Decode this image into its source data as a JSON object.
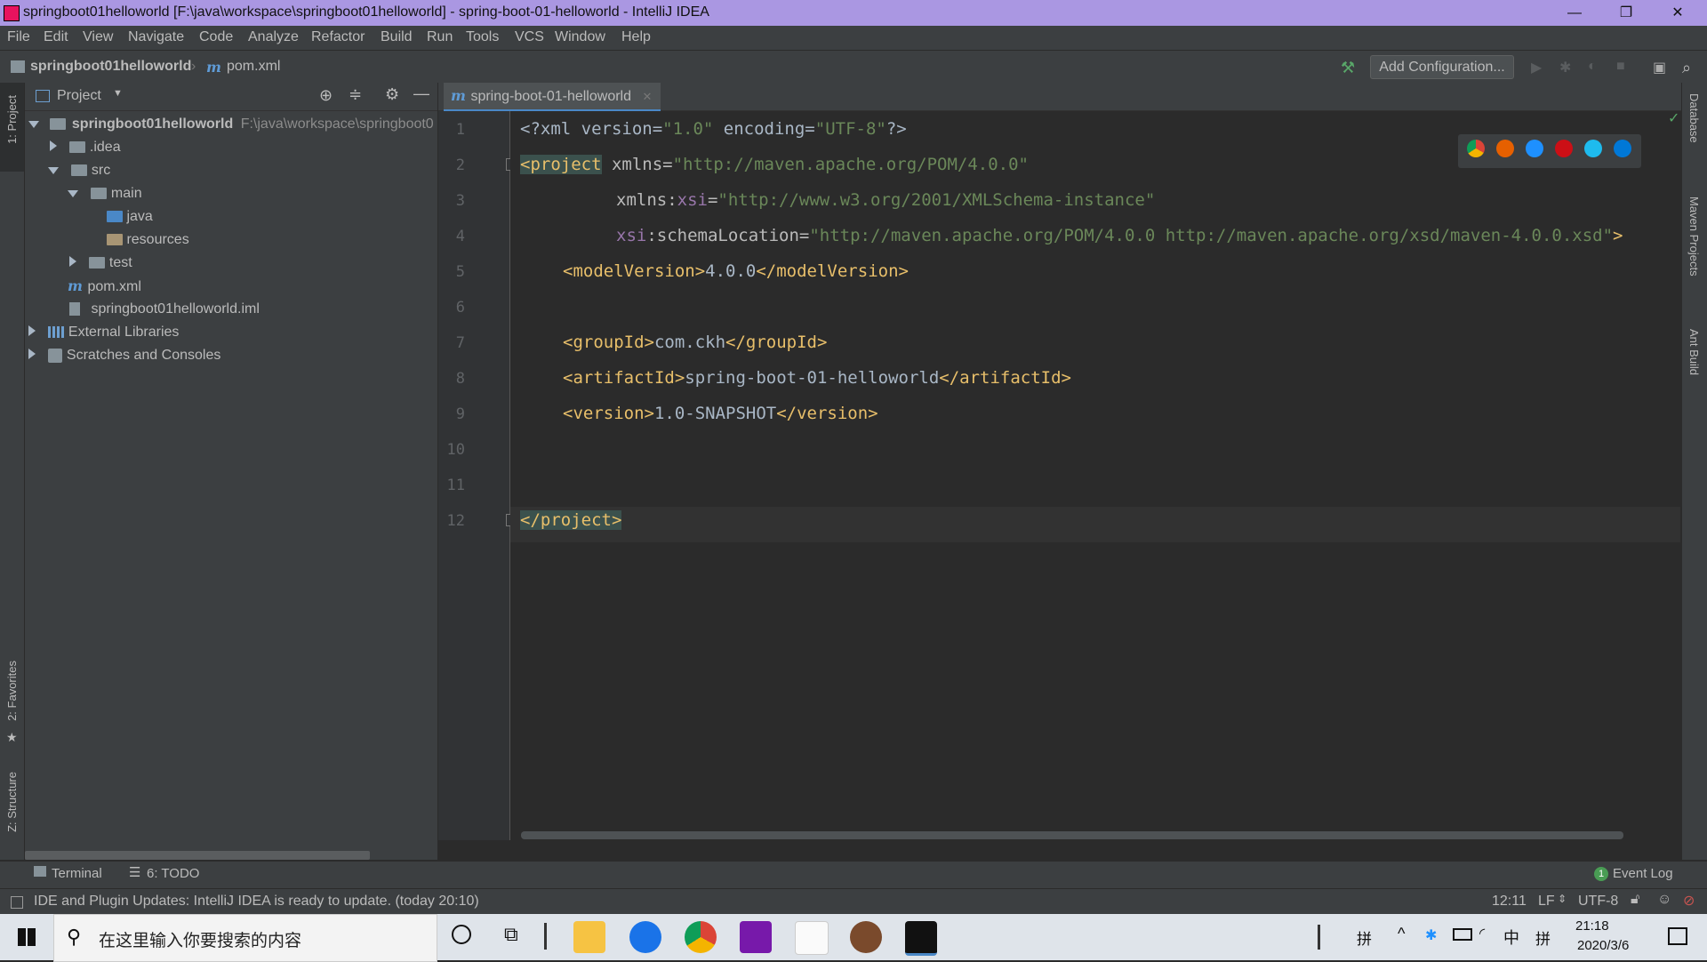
{
  "window": {
    "title": "springboot01helloworld [F:\\java\\workspace\\springboot01helloworld] - spring-boot-01-helloworld - IntelliJ IDEA",
    "controls": [
      "—",
      "❐",
      "✕"
    ]
  },
  "menu": [
    "File",
    "Edit",
    "View",
    "Navigate",
    "Code",
    "Analyze",
    "Refactor",
    "Build",
    "Run",
    "Tools",
    "VCS",
    "Window",
    "Help"
  ],
  "navbar": {
    "crumbs": [
      "springboot01helloworld",
      "pom.xml"
    ],
    "add_configuration": "Add Configuration..."
  },
  "left_stripe": {
    "project": "1: Project",
    "favorites": "2: Favorites",
    "structure": "Z: Structure"
  },
  "project_panel": {
    "title": "Project",
    "tree": [
      {
        "label": "springboot01helloworld",
        "extra": "F:\\java\\workspace\\springboot0"
      },
      {
        "label": ".idea"
      },
      {
        "label": "src"
      },
      {
        "label": "main"
      },
      {
        "label": "java"
      },
      {
        "label": "resources"
      },
      {
        "label": "test"
      },
      {
        "label": "pom.xml"
      },
      {
        "label": "springboot01helloworld.iml"
      },
      {
        "label": "External Libraries"
      },
      {
        "label": "Scratches and Consoles"
      }
    ]
  },
  "editor": {
    "tab": "spring-boot-01-helloworld",
    "line_numbers": [
      "1",
      "2",
      "3",
      "4",
      "5",
      "6",
      "7",
      "8",
      "9",
      "10",
      "11",
      "12"
    ],
    "lines": {
      "l1": [
        "<?xml version=",
        "\"1.0\"",
        " encoding=",
        "\"UTF-8\"",
        "?>"
      ],
      "l2": [
        "<project",
        " xmlns=",
        "\"http://maven.apache.org/POM/4.0.0\""
      ],
      "l3": [
        "xmlns:",
        "xsi",
        "=",
        "\"http://www.w3.org/2001/XMLSchema-instance\""
      ],
      "l4": [
        "xsi",
        ":schemaLocation=",
        "\"http://maven.apache.org/POM/4.0.0 http://maven.apache.org/xsd/maven-4.0.0.xsd\"",
        ">"
      ],
      "l5": [
        "<modelVersion>",
        "4.0.0",
        "</modelVersion>"
      ],
      "l7": [
        "<groupId>",
        "com.ckh",
        "</groupId>"
      ],
      "l8": [
        "<artifactId>",
        "spring-boot-01-helloworld",
        "</artifactId>"
      ],
      "l9": [
        "<version>",
        "1.0-SNAPSHOT",
        "</version>"
      ],
      "l12": [
        "</project>"
      ]
    }
  },
  "right_stripe": [
    "Database",
    "Maven Projects",
    "Ant Build"
  ],
  "tool_strip": {
    "terminal": "Terminal",
    "todo": "6: TODO",
    "event_log": "Event Log",
    "event_count": "1"
  },
  "status": {
    "message": "IDE and Plugin Updates: IntelliJ IDEA is ready to update. (today 20:10)",
    "position": "12:11",
    "line_sep": "LF",
    "encoding": "UTF-8"
  },
  "taskbar": {
    "search_placeholder": "在这里输入你要搜索的内容",
    "ime1": "拼",
    "ime2": "中",
    "ime3": "拼",
    "time": "21:18",
    "date": "2020/3/6"
  },
  "colors": {
    "titlebar": "#aa97e2",
    "tag": "#e8bf6a",
    "string": "#6a8759",
    "namespace": "#9876aa"
  }
}
